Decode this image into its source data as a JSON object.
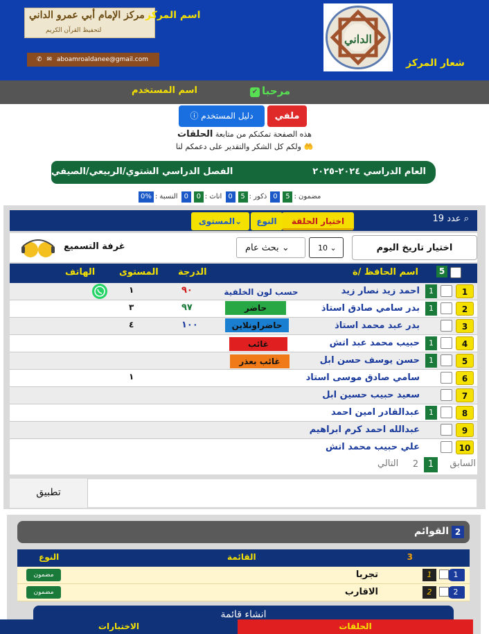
{
  "header": {
    "center_name_label": "اسم المركز",
    "logo_title": "مركز الإمام أبي عمرو الداني",
    "logo_subtitle": "لتحفيظ القرآن الكريم",
    "email": "aboamroaldanee@gmail.com",
    "logo_label": "شعار المركز",
    "badge_text": "الداني"
  },
  "welcome": {
    "greeting": "مرحبا",
    "username_label": "اسم المستخدم"
  },
  "actions": {
    "profile": "ملفي",
    "user_guide": "دليل المستخدم"
  },
  "intro": {
    "line1_prefix": "هذه الصفحة تمكنكم من متابعة",
    "line1_bold": "الحلقات",
    "line2": "ولكم كل الشكر والتقدير على دعمكم لنا"
  },
  "year_bar": {
    "year": "العام الدراسي ٢٠٢٤-٢٠٢٥",
    "semester": "الفصل الدراسي الشتوي/الربيعي/الصيفي"
  },
  "stats": {
    "memorized_label": "مضمون :",
    "memorized": "5",
    "zero1": "0",
    "males_label": "ذكور :",
    "males": "5",
    "zero2": "0",
    "females_label": "اناث :",
    "females": "0",
    "zero3": "0",
    "ratio_label": "النسبة :",
    "ratio": "0%"
  },
  "filters": {
    "count_label": "عدد 19",
    "circle": "اختيار الحلقة",
    "type": "النوع",
    "level": "المستوى"
  },
  "tools": {
    "date_button": "اختيار تاريخ اليوم",
    "page_size": "10",
    "search_scope": "بحث عام",
    "room": "غرفة التسميع"
  },
  "table": {
    "header_count": "5",
    "col_name": "اسم الحافظ /ة",
    "col_grade": "الدرجة",
    "col_level": "المستوى",
    "col_phone": "الهاتف",
    "rows": [
      {
        "num": "1",
        "mark": "1",
        "name": "احمد زيد نصار زيد",
        "grade": "٩٠",
        "grade_color": "#d01818",
        "level": "١"
      },
      {
        "num": "2",
        "mark": "1",
        "name": "بدر سامي صادق استاذ",
        "grade": "٩٧",
        "grade_color": "#1a7a3a",
        "level": "٣"
      },
      {
        "num": "3",
        "mark": "",
        "name": "بدر عبد محمد استاذ",
        "grade": "١٠٠",
        "grade_color": "#1a3a9c",
        "level": "٤"
      },
      {
        "num": "4",
        "mark": "1",
        "name": "حبيب محمد عبد اتش",
        "grade": "",
        "grade_color": "#111",
        "level": ""
      },
      {
        "num": "5",
        "mark": "1",
        "name": "حسن يوسف حسن ابل",
        "grade": "",
        "grade_color": "#111",
        "level": ""
      },
      {
        "num": "6",
        "mark": "",
        "name": "سامي صادق موسى استاد",
        "grade": "",
        "grade_color": "#111",
        "level": "١"
      },
      {
        "num": "7",
        "mark": "",
        "name": "سعيد حبيب حسين ابل",
        "grade": "",
        "grade_color": "#111",
        "level": ""
      },
      {
        "num": "8",
        "mark": "1",
        "name": "عبدالقادر امين احمد",
        "grade": "",
        "grade_color": "#111",
        "level": ""
      },
      {
        "num": "9",
        "mark": "",
        "name": "عبدالله احمد كرم ابراهيم",
        "grade": "",
        "grade_color": "#111",
        "level": ""
      },
      {
        "num": "10",
        "mark": "",
        "name": "علي حبيب محمد اتش",
        "grade": "",
        "grade_color": "#111",
        "level": ""
      }
    ],
    "legend": {
      "bg_note": "حسب لون الخلفية",
      "present": "حاضر",
      "present_online": "حاضراونلاين",
      "absent": "غائب",
      "excused": "غائب بعذر"
    }
  },
  "pager": {
    "prev": "السابق",
    "page1": "1",
    "page2": "2",
    "next": "التالي"
  },
  "apply": {
    "label": "تطبيق"
  },
  "lists": {
    "title": "القوائم",
    "count": "2",
    "col_num": "3",
    "col_list": "القائمة",
    "col_type": "النوع",
    "rows": [
      {
        "num": "1",
        "key": "1",
        "name": "تجربا",
        "type": "مضمون"
      },
      {
        "num": "2",
        "key": "2",
        "name": "الاقارب",
        "type": "مضمون"
      }
    ],
    "create": "انشاء قائمة"
  },
  "bottom_nav": {
    "tests": "الاختبارات",
    "circles": "الحلقات"
  }
}
